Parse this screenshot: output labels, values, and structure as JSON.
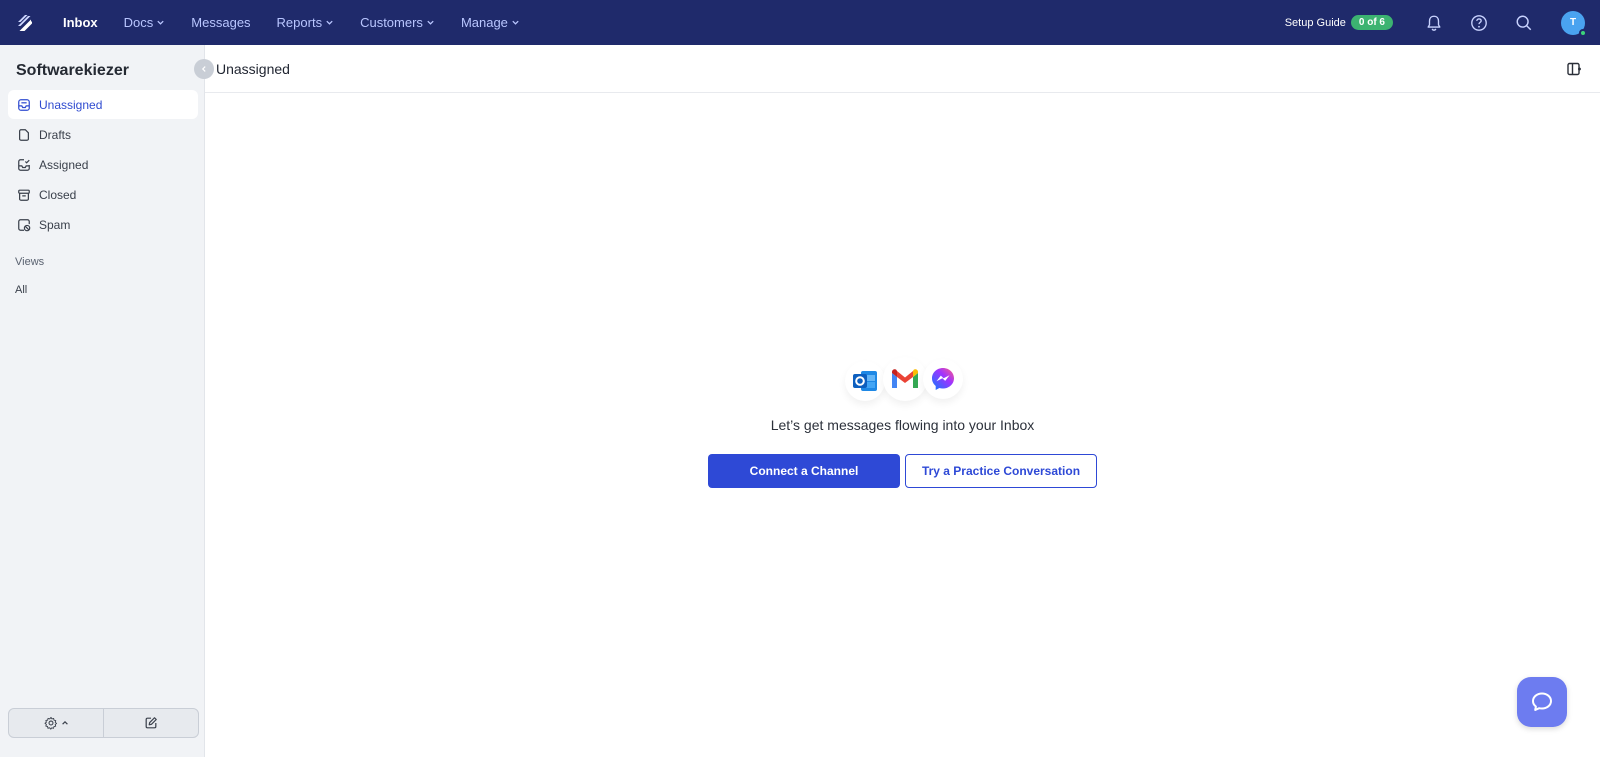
{
  "topnav": {
    "logo_icon": "helpscout-logo-icon",
    "items": [
      {
        "label": "Inbox",
        "active": true,
        "dropdown": false
      },
      {
        "label": "Docs",
        "active": false,
        "dropdown": true
      },
      {
        "label": "Messages",
        "active": false,
        "dropdown": false
      },
      {
        "label": "Reports",
        "active": false,
        "dropdown": true
      },
      {
        "label": "Customers",
        "active": false,
        "dropdown": true
      },
      {
        "label": "Manage",
        "active": false,
        "dropdown": true
      }
    ],
    "setup_guide_label": "Setup Guide",
    "setup_guide_progress": "0 of 6",
    "avatar_initial": "T",
    "background_color": "#1f2a6b"
  },
  "sidebar": {
    "workspace_name": "Softwarekiezer",
    "folders": [
      {
        "label": "Unassigned",
        "icon": "inbox-icon",
        "active": true
      },
      {
        "label": "Drafts",
        "icon": "draft-icon",
        "active": false
      },
      {
        "label": "Assigned",
        "icon": "assigned-icon",
        "active": false
      },
      {
        "label": "Closed",
        "icon": "archive-icon",
        "active": false
      },
      {
        "label": "Spam",
        "icon": "spam-icon",
        "active": false
      }
    ],
    "views_label": "Views",
    "views": [
      {
        "label": "All"
      }
    ]
  },
  "main": {
    "title": "Unassigned",
    "empty_message": "Let’s get messages flowing into your Inbox",
    "channels": [
      "outlook-icon",
      "gmail-icon",
      "messenger-icon"
    ],
    "primary_button": "Connect a Channel",
    "secondary_button": "Try a Practice Conversation",
    "accent_color": "#2e49d6"
  }
}
